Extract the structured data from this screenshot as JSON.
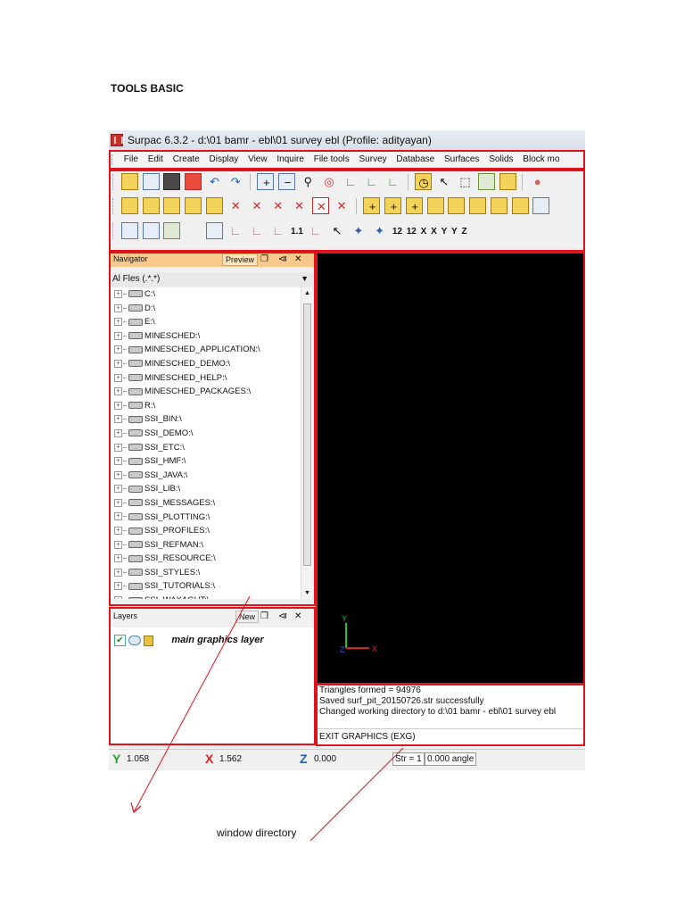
{
  "heading": "TOOLS BASIC",
  "caption": "window directory",
  "app": {
    "title": "Surpac 6.3.2 - d:\\01 bamr - ebl\\01 survey ebl (Profile: adityayan)",
    "menu": [
      "File",
      "Edit",
      "Create",
      "Display",
      "View",
      "Inquire",
      "File tools",
      "Survey",
      "Database",
      "Surfaces",
      "Solids",
      "Block mo"
    ],
    "toolbar3_labels": [
      "1.1",
      "12",
      "12",
      "X",
      "X",
      "Y",
      "Y",
      "Z"
    ]
  },
  "navigator": {
    "title": "Navigator",
    "tab": "Preview",
    "filter": "Al Fles (.*.*)",
    "drives": [
      "C:\\",
      "D:\\",
      "E:\\",
      "MINESCHED:\\",
      "MINESCHED_APPLICATION:\\",
      "MINESCHED_DEMO:\\",
      "MINESCHED_HELP:\\",
      "MINESCHED_PACKAGES:\\",
      "R:\\",
      "SSI_BIN:\\",
      "SSI_DEMO:\\",
      "SSI_ETC:\\",
      "SSI_HMF:\\",
      "SSI_JAVA:\\",
      "SSI_LIB:\\",
      "SSI_MESSAGES:\\",
      "SSI_PLOTTING:\\",
      "SSI_PROFILES:\\",
      "SSI_REFMAN:\\",
      "SSI_RESOURCE:\\",
      "SSI_STYLES:\\",
      "SSI_TUTORIALS:\\",
      "SSI_WAXAGUT:\\"
    ]
  },
  "layers": {
    "title": "Layers",
    "tab": "New",
    "layer_name": "main graphics layer"
  },
  "axes": {
    "y": "Y",
    "z": "Z",
    "x": "X"
  },
  "console": {
    "lines": [
      "Triangles formed = 94976",
      "Saved surf_pit_20150726.str successfully",
      "Changed working directory to d:\\01 bamr - ebl\\01 survey ebl"
    ],
    "command": "EXIT GRAPHICS (EXG)"
  },
  "status": {
    "y_value": "1.058",
    "x_value": "1.562",
    "z_value": "0.000",
    "string": "Str = 1",
    "angle": "0.000 angle"
  },
  "colors": {
    "highlight": "#e0131c",
    "panel_header": "#f8c98a",
    "canvas": "#000000"
  }
}
